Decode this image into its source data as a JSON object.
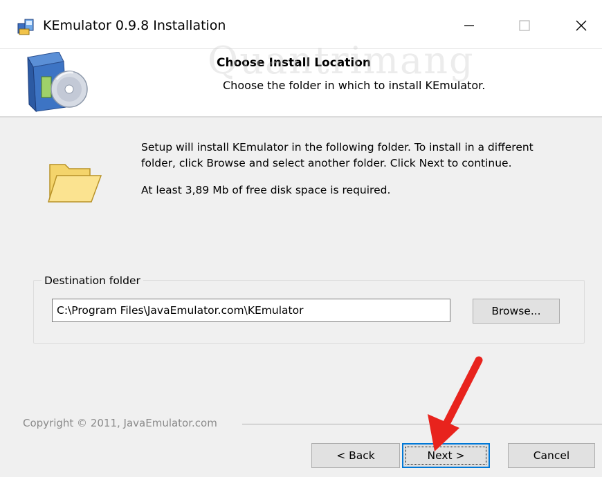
{
  "window": {
    "title": "KEmulator 0.9.8 Installation",
    "icons": {
      "app": "installer-icon",
      "minimize": "minimize-icon",
      "maximize": "maximize-icon",
      "close": "close-icon"
    }
  },
  "header": {
    "title": "Choose Install Location",
    "subtitle": "Choose the folder in which to install KEmulator.",
    "watermark": "Quantrimang",
    "icon": "install-disc-box-icon"
  },
  "body": {
    "description": "Setup will install KEmulator in the following folder. To install in a different folder, click Browse and select another folder. Click Next to continue.",
    "space_required": "At least 3,89 Mb of free disk space is required.",
    "icon": "folder-open-icon"
  },
  "destination": {
    "group_label": "Destination folder",
    "path": "C:\\Program Files\\JavaEmulator.com\\KEmulator",
    "browse_label": "Browse..."
  },
  "footer": {
    "copyright": "Copyright © 2011, JavaEmulator.com",
    "back_label": "< Back",
    "next_label": "Next >",
    "cancel_label": "Cancel"
  },
  "colors": {
    "accent_focus": "#0078d7",
    "annotation_arrow": "#e8231d",
    "dialog_background": "#f0f0f0"
  }
}
